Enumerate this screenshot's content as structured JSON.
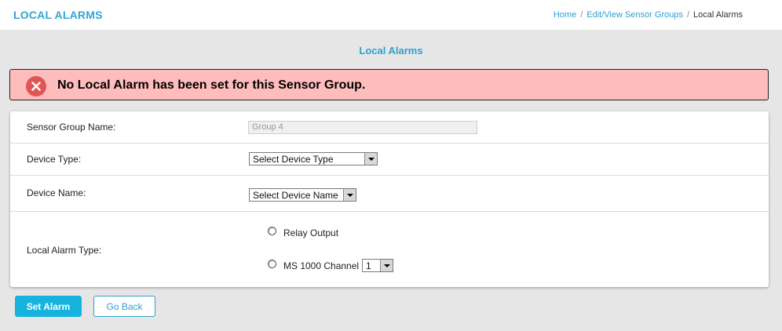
{
  "header": {
    "title": "LOCAL ALARMS",
    "breadcrumb": {
      "home": "Home",
      "sensor_groups": "Edit/View Sensor Groups",
      "current": "Local Alarms"
    }
  },
  "section_title": "Local Alarms",
  "error": {
    "message": "No Local Alarm has been set for this Sensor Group.",
    "icon": "close-icon",
    "color": "#ffbcbc"
  },
  "form": {
    "sensor_group_name": {
      "label": "Sensor Group Name:",
      "value": "Group 4"
    },
    "device_type": {
      "label": "Device Type:",
      "selected": "Select Device Type"
    },
    "device_name": {
      "label": "Device Name:",
      "selected": "Select Device Name"
    },
    "local_alarm_type": {
      "label": "Local Alarm Type:",
      "options": {
        "relay_output": "Relay Output",
        "ms_channel": "MS 1000 Channel"
      },
      "channel_selected": "1"
    }
  },
  "buttons": {
    "set_alarm": "Set Alarm",
    "go_back": "Go Back"
  },
  "colors": {
    "accent": "#2f9fd0",
    "primary_button": "#16b3df",
    "error_icon": "#e05656"
  }
}
